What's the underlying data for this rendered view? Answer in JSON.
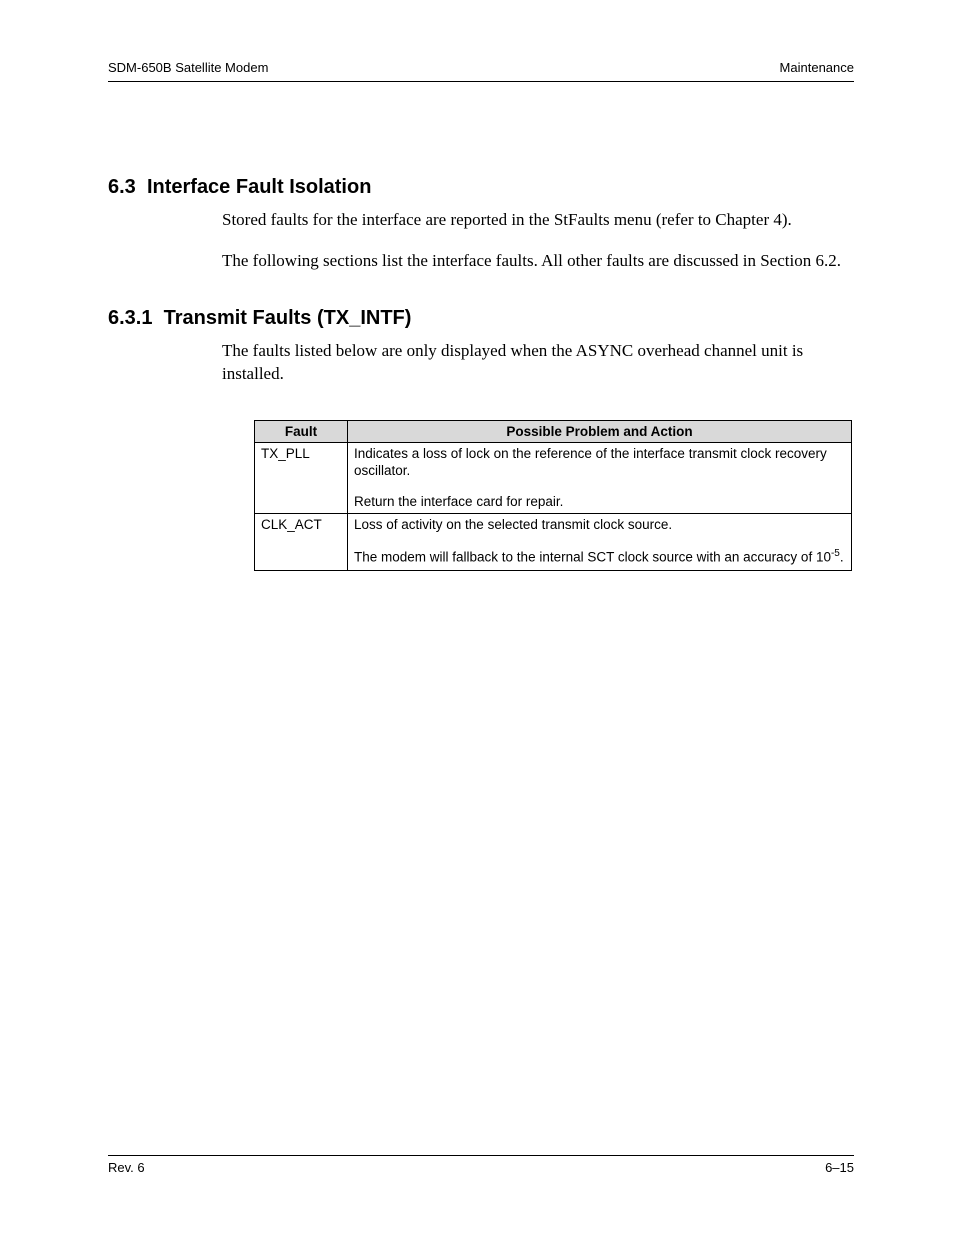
{
  "header": {
    "left": "SDM-650B Satellite Modem",
    "right": "Maintenance"
  },
  "section": {
    "number": "6.3",
    "title": "Interface Fault Isolation",
    "para1": "Stored faults for the interface are reported in the StFaults menu (refer to Chapter 4).",
    "para2": "The following sections list the interface faults. All other faults are discussed in Section 6.2."
  },
  "subsection": {
    "number": "6.3.1",
    "title": "Transmit Faults (TX_INTF)",
    "para1": "The faults listed below are only displayed when the ASYNC overhead channel unit is installed."
  },
  "table": {
    "headers": {
      "fault": "Fault",
      "action": "Possible Problem and Action"
    },
    "rows": [
      {
        "fault": "TX_PLL",
        "action_a": "Indicates a loss of lock on the reference of the interface transmit clock recovery oscillator.",
        "action_b": "Return the interface card for repair."
      },
      {
        "fault": "CLK_ACT",
        "action_a": "Loss of activity on the selected transmit clock source.",
        "action_b_pre": "The modem will fallback to the internal SCT clock source with an accuracy of 10",
        "action_b_sup": "-5",
        "action_b_post": "."
      }
    ]
  },
  "footer": {
    "left": "Rev. 6",
    "right": "6–15"
  }
}
